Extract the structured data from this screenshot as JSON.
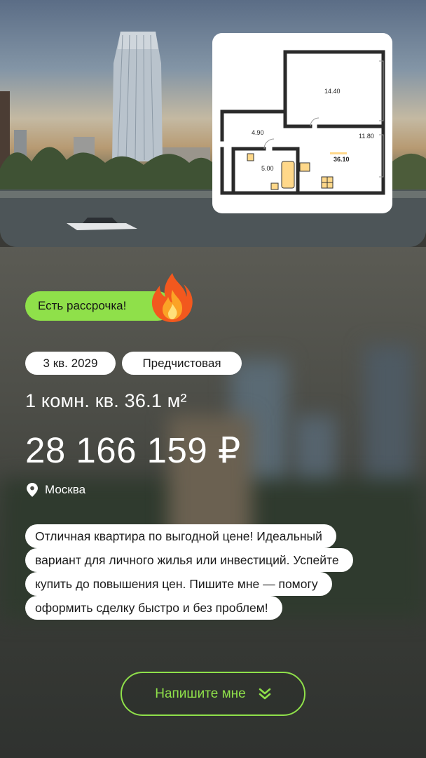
{
  "hero": {
    "floor_plan": {
      "room_areas": [
        "14.40",
        "4.90",
        "5.00",
        "11.80"
      ],
      "total_area": "36.10"
    }
  },
  "badge": {
    "installment_label": "Есть рассрочка!"
  },
  "tags": {
    "completion": "3 кв. 2029",
    "finish": "Предчистовая"
  },
  "listing": {
    "title": "1 комн. кв. 36.1 м²",
    "price": "28 166 159 ₽",
    "city": "Москва"
  },
  "description_lines": [
    "Отличная квартира по выгодной цене! Идеальный",
    "вариант для личного жилья или инвестиций. Успейте",
    "купить до повышения цен. Пишите мне — помогу",
    "оформить сделку быстро и без проблем!"
  ],
  "cta": {
    "label": "Напишите мне"
  },
  "colors": {
    "accent": "#8fe04a",
    "text": "#ffffff",
    "chip": "#ffffff"
  },
  "icons": {
    "location": "location-pin-icon",
    "cta": "double-chevron-down-icon",
    "badge": "fire-icon"
  }
}
